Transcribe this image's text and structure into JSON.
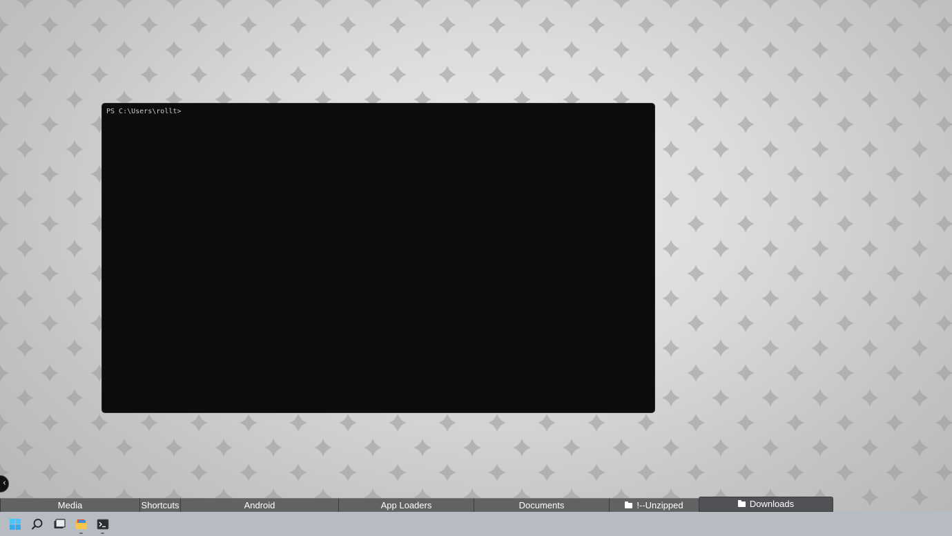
{
  "terminal": {
    "prompt": "PS C:\\Users\\rollt>"
  },
  "back_button": {
    "glyph": "‹"
  },
  "folder_bar": {
    "tabs": [
      {
        "label": "Media",
        "has_folder_icon": false,
        "active": false
      },
      {
        "label": "Shortcuts",
        "has_folder_icon": false,
        "active": false
      },
      {
        "label": "Android",
        "has_folder_icon": false,
        "active": false
      },
      {
        "label": "App Loaders",
        "has_folder_icon": false,
        "active": false
      },
      {
        "label": "Documents",
        "has_folder_icon": false,
        "active": false
      },
      {
        "label": "!--Unzipped",
        "has_folder_icon": true,
        "active": false
      },
      {
        "label": "Downloads",
        "has_folder_icon": true,
        "active": true
      }
    ]
  },
  "taskbar": {
    "icons": [
      {
        "name": "start-icon",
        "running": false
      },
      {
        "name": "search-icon",
        "running": false
      },
      {
        "name": "task-view-icon",
        "running": false
      },
      {
        "name": "file-explorer-icon",
        "running": true
      },
      {
        "name": "terminal-icon",
        "running": true
      }
    ]
  },
  "colors": {
    "terminal_bg": "#0c0c0c",
    "taskbar_bg": "#b7bcc3",
    "folder_tab_bg": "#616264",
    "start_blue": "#4cc2ff"
  }
}
